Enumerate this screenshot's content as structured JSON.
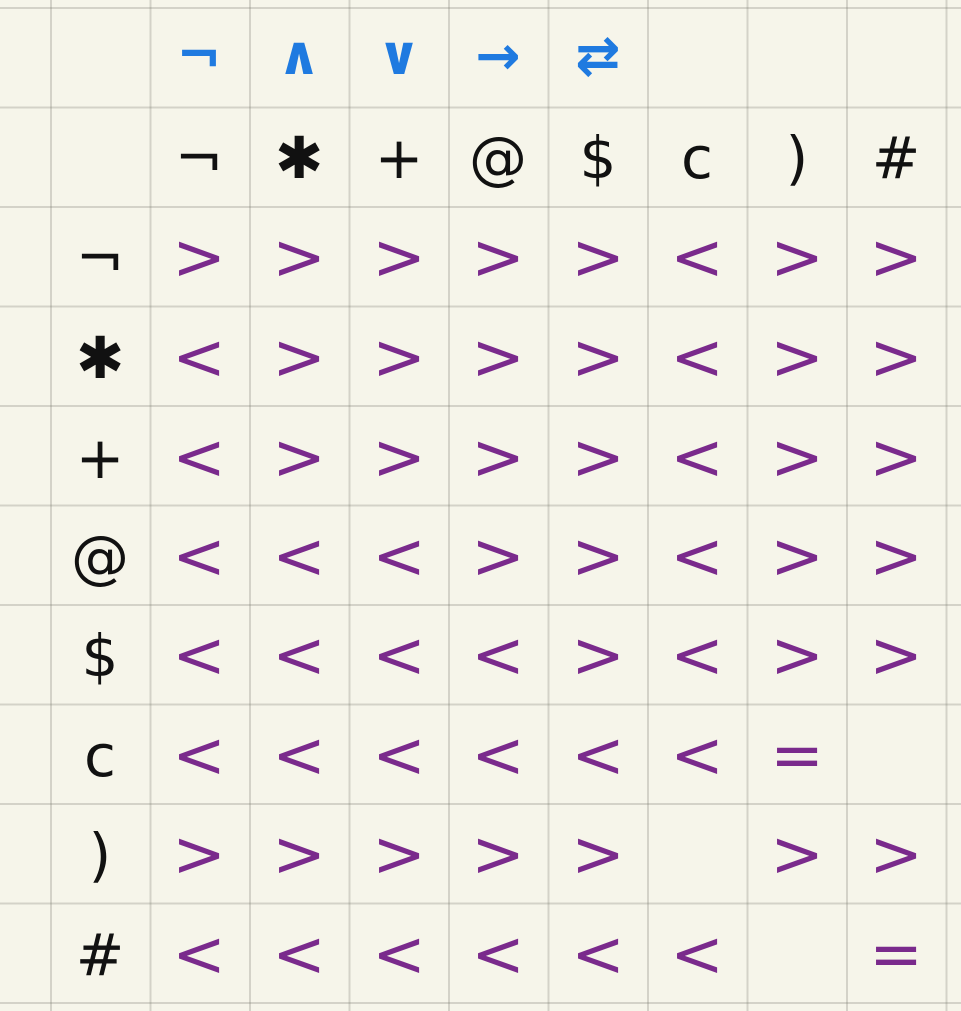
{
  "operators": [
    "¬",
    "∧",
    "∨",
    "→",
    "⇄"
  ],
  "columns": [
    "¬",
    "✱",
    "+",
    "@",
    "$",
    "c",
    ")",
    "#"
  ],
  "rows": [
    {
      "symbol": "¬",
      "cells": [
        ">",
        ">",
        ">",
        ">",
        ">",
        "<",
        ">",
        ">"
      ]
    },
    {
      "symbol": "✱",
      "cells": [
        "<",
        ">",
        ">",
        ">",
        ">",
        "<",
        ">",
        ">"
      ]
    },
    {
      "symbol": "+",
      "cells": [
        "<",
        ">",
        ">",
        ">",
        ">",
        "<",
        ">",
        ">"
      ]
    },
    {
      "symbol": "@",
      "cells": [
        "<",
        "<",
        "<",
        ">",
        ">",
        "<",
        ">",
        ">"
      ]
    },
    {
      "symbol": "$",
      "cells": [
        "<",
        "<",
        "<",
        "<",
        ">",
        "<",
        ">",
        ">"
      ]
    },
    {
      "symbol": "c",
      "cells": [
        "<",
        "<",
        "<",
        "<",
        "<",
        "<",
        "=",
        ""
      ]
    },
    {
      "symbol": ")",
      "cells": [
        ">",
        ">",
        ">",
        ">",
        ">",
        "",
        ">",
        ">"
      ]
    },
    {
      "symbol": "#",
      "cells": [
        "<",
        "<",
        "<",
        "<",
        "<",
        "<",
        "",
        "="
      ]
    }
  ],
  "colors": {
    "operator": "#1f7ae0",
    "symbol": "#111111",
    "relation": "#7a2a8c",
    "paper": "#f6f5ea",
    "grid": "#b5b5aa"
  }
}
